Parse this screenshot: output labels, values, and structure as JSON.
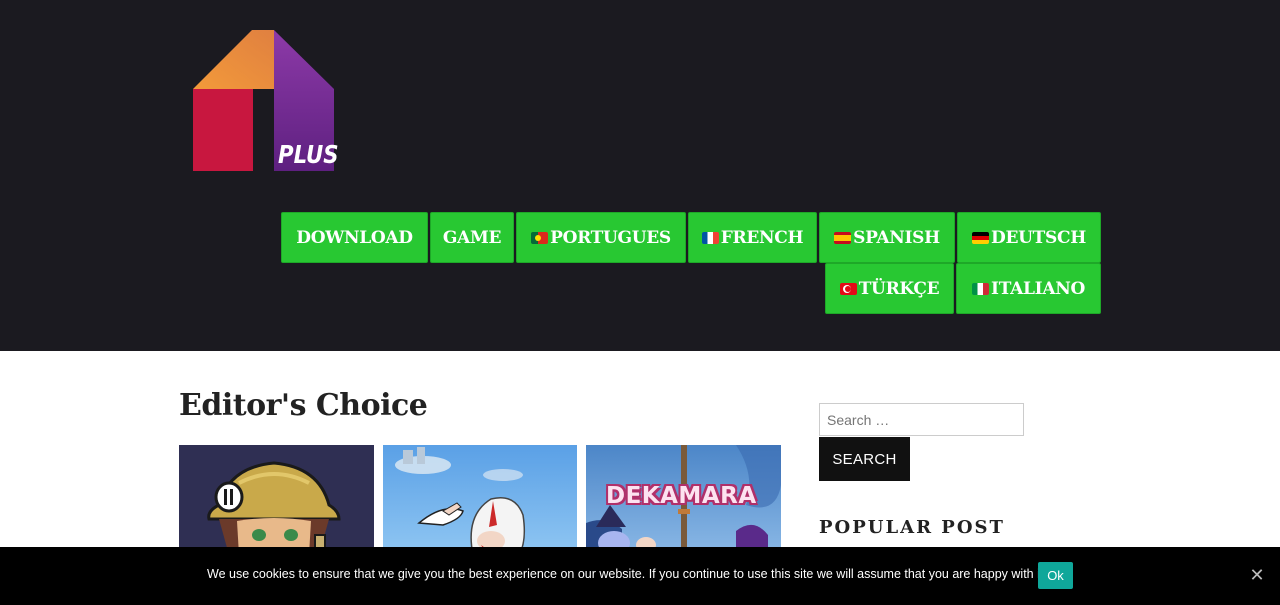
{
  "header": {
    "logo_text": "PLUS",
    "nav": [
      {
        "label": "DOWNLOAD",
        "flag": null
      },
      {
        "label": "GAME",
        "flag": null
      },
      {
        "label": "PORTUGUES",
        "flag": "portugal-flag-icon"
      },
      {
        "label": "FRENCH",
        "flag": "france-flag-icon"
      },
      {
        "label": "SPANISH",
        "flag": "spain-flag-icon"
      },
      {
        "label": "DEUTSCH",
        "flag": "germany-flag-icon"
      },
      {
        "label": "TÜRKÇE",
        "flag": "turkey-flag-icon"
      },
      {
        "label": "ITALIANO",
        "flag": "italy-flag-icon"
      }
    ]
  },
  "main": {
    "title": "Editor's Choice",
    "thumbnails": [
      {
        "caption": ""
      },
      {
        "caption": ""
      },
      {
        "caption": "DEKAMARA"
      }
    ]
  },
  "sidebar": {
    "search_placeholder": "Search …",
    "search_button": "SEARCH",
    "popular_heading": "POPULAR POST"
  },
  "cookie": {
    "text": "We use cookies to ensure that we give you the best experience on our website. If you continue to use this site we will assume that you are happy with it.",
    "ok_label": "Ok",
    "close_glyph": "✕"
  },
  "colors": {
    "header_bg": "#1b1a20",
    "nav_green": "#28c832",
    "cookie_ok": "#0fa79a"
  }
}
